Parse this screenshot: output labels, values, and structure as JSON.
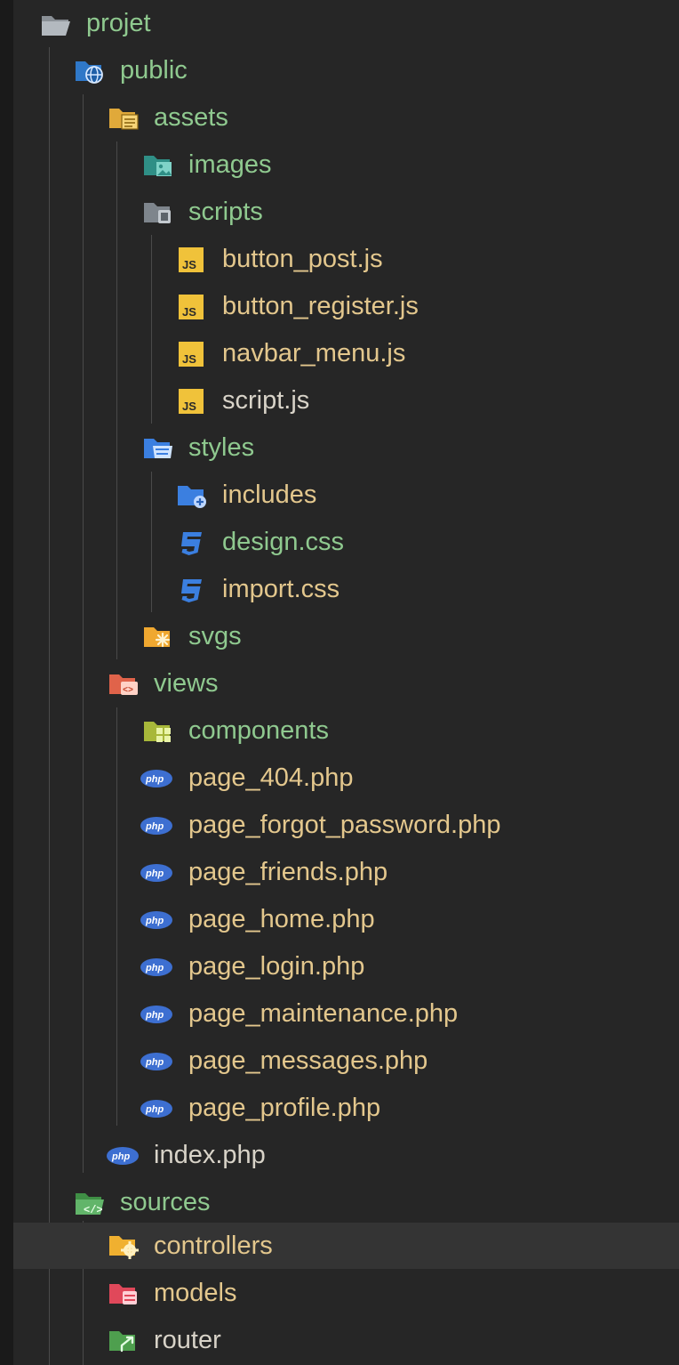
{
  "tree": {
    "projet": "projet",
    "public": "public",
    "assets": "assets",
    "images": "images",
    "scripts": "scripts",
    "button_post": "button_post.js",
    "button_register": "button_register.js",
    "navbar_menu": "navbar_menu.js",
    "script": "script.js",
    "styles": "styles",
    "includes": "includes",
    "design_css": "design.css",
    "import_css": "import.css",
    "svgs": "svgs",
    "views": "views",
    "components": "components",
    "page_404": "page_404.php",
    "page_forgot_password": "page_forgot_password.php",
    "page_friends": "page_friends.php",
    "page_home": "page_home.php",
    "page_login": "page_login.php",
    "page_maintenance": "page_maintenance.php",
    "page_messages": "page_messages.php",
    "page_profile": "page_profile.php",
    "index_php": "index.php",
    "sources": "sources",
    "controllers": "controllers",
    "models": "models",
    "router": "router"
  },
  "icon_text": {
    "js": "JS",
    "php": "php"
  },
  "selected_item": "controllers",
  "colors": {
    "background": "#262626",
    "selection": "#343434",
    "folder_text": "#8fc98f",
    "file_text": "#e3c78d",
    "js_badge": "#f0c23a",
    "php_badge": "#3d6fd1",
    "css_icon": "#3b7fe0"
  }
}
